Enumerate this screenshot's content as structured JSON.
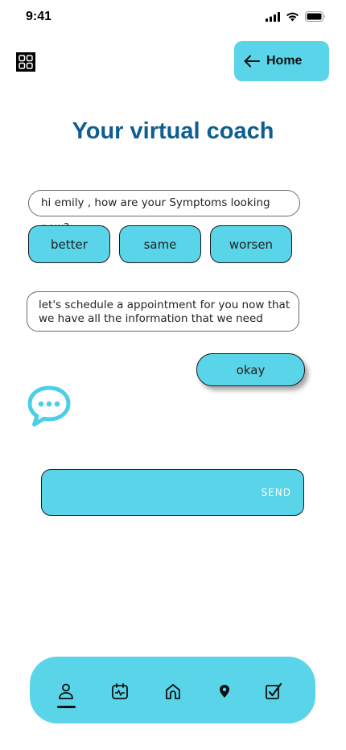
{
  "status_bar": {
    "time": "9:41"
  },
  "header": {
    "home_label": "Home"
  },
  "page": {
    "title": "Your virtual coach"
  },
  "chat": {
    "question": "hi emily , how are your Symptoms looking now?",
    "options": [
      "better",
      "same",
      "worsen"
    ],
    "message": "let's schedule a appointment for you now that we have all the information that we need",
    "reply_button": "okay"
  },
  "composer": {
    "input_value": "",
    "send_label": "SEND"
  },
  "bottom_nav": {
    "items": [
      "profile-icon",
      "calendar-icon",
      "home-icon",
      "location-pin-icon",
      "checklist-icon"
    ],
    "active": "profile-icon"
  },
  "colors": {
    "accent": "#59d4e8",
    "title": "#0e5e8e"
  }
}
